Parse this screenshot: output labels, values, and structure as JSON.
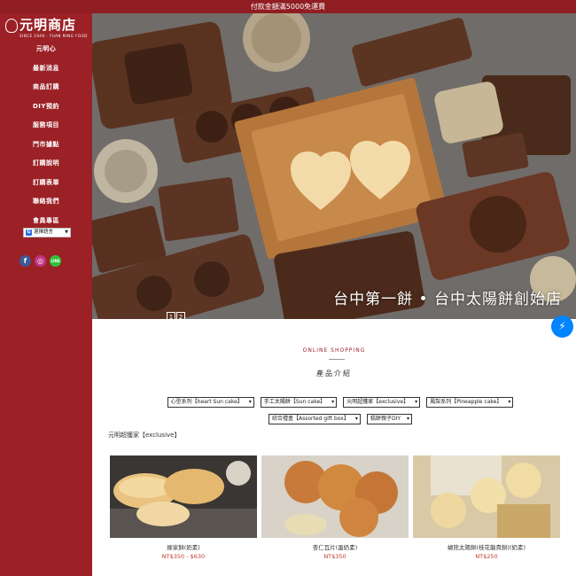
{
  "topbar": {
    "text": "付款金額滿5000免運費"
  },
  "brand": {
    "name": "元明商店",
    "tagline": "SINCE 1949 · YUAN MING FOOD"
  },
  "nav": {
    "items": [
      "元明心",
      "最新消息",
      "商品訂購",
      "DIY預約",
      "服務項目",
      "門市據點",
      "訂購說明",
      "訂購表單",
      "聯絡我們",
      "會員專區"
    ]
  },
  "language": {
    "label": "選擇語言",
    "caret": "▼",
    "icon": "G"
  },
  "social": {
    "facebook": "f",
    "instagram": "◎",
    "line": "LINE"
  },
  "hero": {
    "caption": "台中第一餅 • 台中太陽餅創始店",
    "slides": [
      "1",
      "2"
    ]
  },
  "messenger": {
    "icon": "⚡"
  },
  "section": {
    "subtitle": "ONLINE SHOPPING",
    "title": "產品介紹"
  },
  "filters": [
    "心型系列【heart Sun cake】",
    "手工太陽餅【Sun cake】",
    "元明超獲家【exclusive】",
    "鳳梨系列【Pineapple cake】",
    "綜合禮盒【Assorted gift box】",
    "糕餅親子DIY"
  ],
  "breadcrumb": "元明超獲家【exclusive】",
  "products": [
    {
      "name": "嫁家餅(奶素)",
      "price": "NT$350 - $630"
    },
    {
      "name": "杏仁瓦片(蛋奶素)",
      "price": "NT$350"
    },
    {
      "name": "蝴熊太陽餅(桂花龍貴餅)(奶素)",
      "price": "NT$250"
    }
  ],
  "colors": {
    "brand_red": "#9b2126",
    "price_red": "#c0392b",
    "messenger_blue": "#0084ff"
  }
}
